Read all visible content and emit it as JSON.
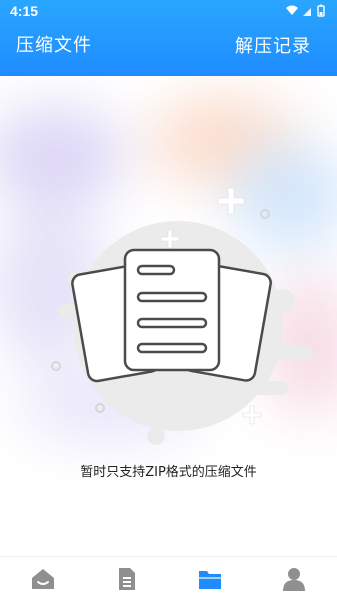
{
  "status_bar": {
    "time": "4:15",
    "icons": [
      "wifi-icon",
      "signal-icon",
      "battery-icon"
    ]
  },
  "header": {
    "title": "压缩文件",
    "action_label": "解压记录",
    "background_color": "#1e8cff"
  },
  "content": {
    "empty_message": "暂时只支持ZIP格式的压缩文件"
  },
  "tabbar": {
    "tabs": [
      {
        "icon": "home-icon",
        "active": false,
        "color": "#8f8f8f"
      },
      {
        "icon": "document-icon",
        "active": false,
        "color": "#8f8f8f"
      },
      {
        "icon": "folder-icon",
        "active": true,
        "color": "#1e8cff"
      },
      {
        "icon": "user-icon",
        "active": false,
        "color": "#8f8f8f"
      }
    ]
  }
}
